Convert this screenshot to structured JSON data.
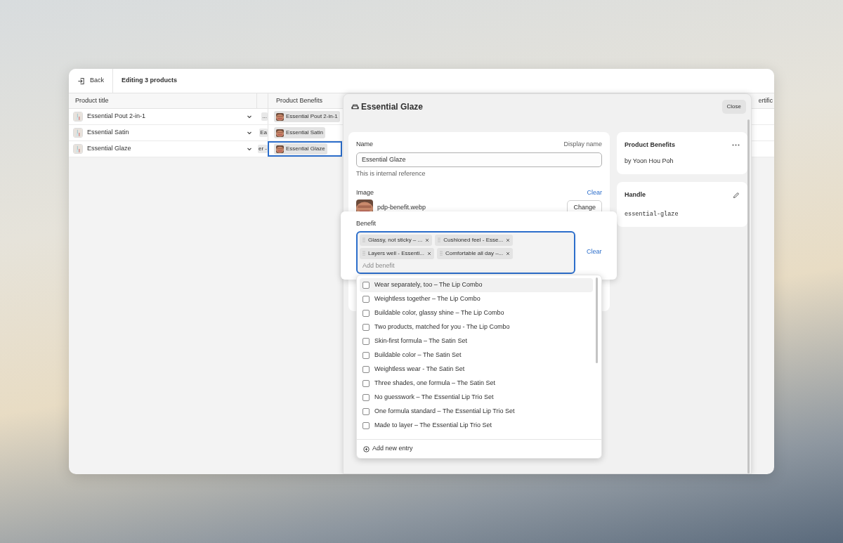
{
  "header": {
    "back": "Back",
    "title": "Editing 3 products"
  },
  "table": {
    "columns": {
      "title": "Product title",
      "benefits": "Product Benefits",
      "column_4": "ertific"
    },
    "rows": [
      {
        "title": "Essential Pout 2-in-1",
        "column_2": "...",
        "benefit": "Essential Pout 2-in-1",
        "selected": false
      },
      {
        "title": "Essential Satin",
        "column_2": "Ea",
        "benefit": "Essential Satin",
        "selected": false
      },
      {
        "title": "Essential Glaze",
        "column_2": "er -",
        "benefit": "Essential Glaze",
        "selected": true
      }
    ]
  },
  "drawer": {
    "title": "Essential Glaze",
    "close": "Close",
    "form": {
      "name_label": "Name",
      "name_hint": "Display name",
      "name_value": "Essential Glaze",
      "help": "This is internal reference",
      "image_label": "Image",
      "image_clear": "Clear",
      "image_file": "pdp-benefit.webp",
      "change": "Change"
    },
    "side": [
      {
        "kind": "app",
        "title": "Product Benefits",
        "subtitle": "by Yoon Hou Poh"
      },
      {
        "kind": "handle",
        "title": "Handle",
        "value": "essential-glaze"
      }
    ]
  },
  "benefit": {
    "label": "Benefit",
    "tags": [
      "Glassy, not sticky – ...",
      "Cushioned feel - Esse...",
      "Layers well - Essenti...",
      "Comfortable all day –..."
    ],
    "placeholder": "Add benefit",
    "clear": "Clear"
  },
  "dropdown": {
    "options": [
      {
        "label": "Wear separately, too – The Lip Combo",
        "checked": false,
        "selected": true
      },
      {
        "label": "Weightless together – The Lip Combo",
        "checked": false,
        "selected": false
      },
      {
        "label": "Buildable color, glassy shine – The Lip Combo",
        "checked": false,
        "selected": false
      },
      {
        "label": "Two products, matched for you - The Lip Combo",
        "checked": false,
        "selected": false
      },
      {
        "label": "Skin-first formula – The Satin Set",
        "checked": false,
        "selected": false
      },
      {
        "label": "Buildable color – The Satin Set",
        "checked": false,
        "selected": false
      },
      {
        "label": "Weightless wear - The Satin Set",
        "checked": false,
        "selected": false
      },
      {
        "label": "Three shades, one formula – The Satin Set",
        "checked": false,
        "selected": false
      },
      {
        "label": "No guesswork – The Essential Lip Trio Set",
        "checked": false,
        "selected": false
      },
      {
        "label": "One formula standard – The Essential Lip Trio Set",
        "checked": false,
        "selected": false
      },
      {
        "label": "Made to layer – The Essential Lip Trio Set",
        "checked": false,
        "selected": false
      }
    ],
    "add": "Add new entry"
  }
}
